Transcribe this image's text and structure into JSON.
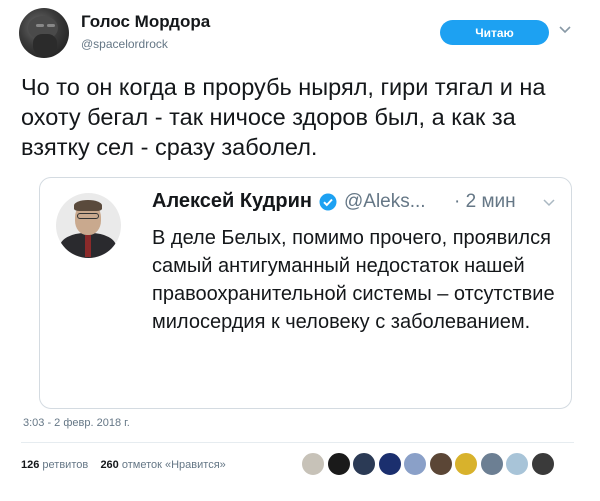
{
  "tweet": {
    "author": {
      "name": "Голос Мордора",
      "handle": "@spacelordrock"
    },
    "follow_button": "Читаю",
    "text": "Чо то он когда в прорубь нырял, гири тягал и на охоту бегал - так ничосе здоров был, а как за взятку сел - сразу заболел.",
    "quoted": {
      "name": "Алексей Кудрин",
      "handle": "@Aleks...",
      "time": "· 2 мин",
      "text": "В деле Белых, помимо прочего, проявился самый антигуманный недостаток нашей правоохранительной системы – отсутствие милосердия к человеку с заболеванием."
    },
    "timestamp": "3:03 - 2 февр. 2018 г.",
    "retweets_count": "126",
    "retweets_label": "ретвитов",
    "likes_count": "260",
    "likes_label": "отметок «Нравится»"
  },
  "colors": {
    "accent": "#1da1f2",
    "text": "#14171a",
    "muted": "#657786",
    "border": "#d4dbe1"
  },
  "icons": [
    "chevron-down-icon",
    "verified-badge-icon"
  ],
  "liker_avatars": [
    "#c7c2b8",
    "#1a1a1a",
    "#2b3a55",
    "#1b2f6e",
    "#8aa0c8",
    "#5b4636",
    "#d8b22c",
    "#6c7f93",
    "#a8c4d8",
    "#3a3a3a"
  ]
}
